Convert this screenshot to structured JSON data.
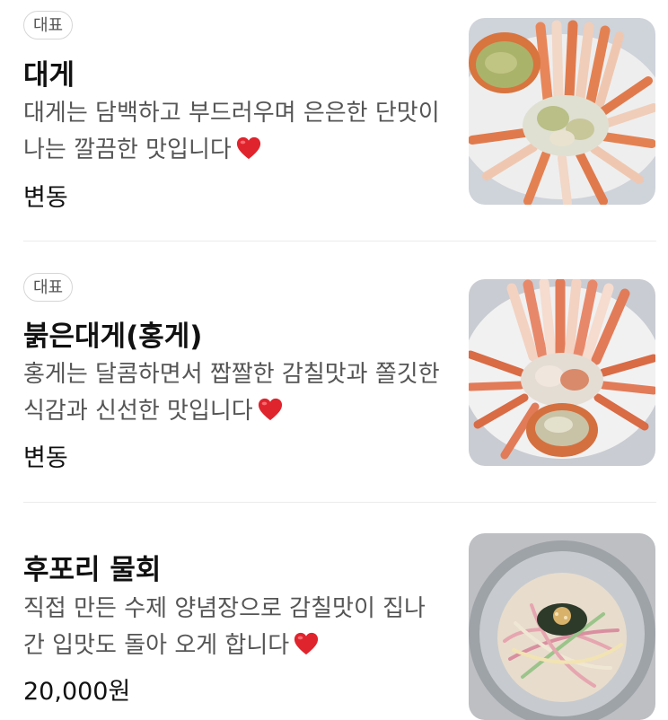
{
  "menu": {
    "items": [
      {
        "badge": "대표",
        "name": "대게",
        "description": "대게는 담백하고 부드러우며 은은한 단맛이 나는 깔끔한 맛입니다",
        "price": "변동",
        "image": "snow-crab-platter"
      },
      {
        "badge": "대표",
        "name": "붉은대게(홍게)",
        "description": "홍게는 달콤하면서 짭짤한 감칠맛과 쫄깃한 식감과 신선한 맛입니다",
        "price": "변동",
        "image": "red-snow-crab-platter"
      },
      {
        "name": "후포리 물회",
        "description": "직접 만든 수제 양념장으로 감칠맛이 집나간 입맛도 돌아 오게 합니다",
        "price": "20,000원",
        "image": "mulhoe-bowl"
      }
    ],
    "heart_icon": "red-heart-icon",
    "colors": {
      "heart": "#e0242d",
      "badge_border": "#d6d6d6",
      "divider": "#ececec"
    }
  }
}
